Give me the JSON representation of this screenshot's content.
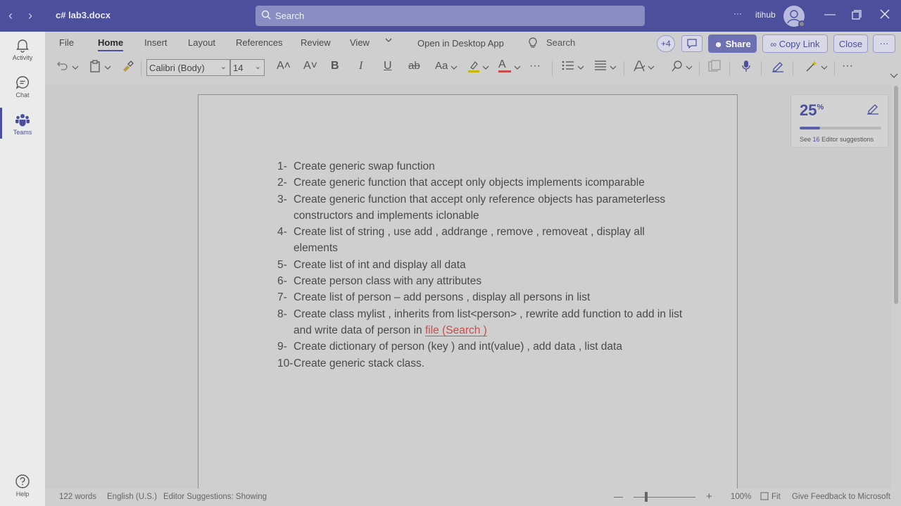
{
  "titlebar": {
    "back_glyph": "‹",
    "forward_glyph": "›",
    "doc_title": "c# lab3.docx",
    "search_placeholder": "Search",
    "more_glyph": "···",
    "org_name": "itihub"
  },
  "rail": {
    "items": [
      {
        "label": "Activity",
        "icon": "bell-icon"
      },
      {
        "label": "Chat",
        "icon": "chat-icon"
      },
      {
        "label": "Teams",
        "icon": "teams-icon"
      },
      {
        "label": "Help",
        "icon": "help-icon"
      }
    ],
    "active": "Teams"
  },
  "ribbon": {
    "tabs": [
      "File",
      "Home",
      "Insert",
      "Layout",
      "References",
      "Review",
      "View"
    ],
    "active_tab": "Home",
    "open_desktop": "Open in Desktop App",
    "search_label": "Search",
    "collaborators": "+4",
    "share": "Share",
    "copy_link": "Copy Link",
    "close": "Close",
    "font_name": "Calibri (Body)",
    "font_size": "14",
    "bold": "B",
    "italic": "I",
    "underline": "U",
    "strike": "ab",
    "case": "Aa",
    "font_color_glyph": "A",
    "grow_glyph": "A˄",
    "shrink_glyph": "A˅",
    "ellipsis": "···"
  },
  "document": {
    "items": [
      {
        "num": "1-",
        "text": "Create generic swap function"
      },
      {
        "num": "2-",
        "text": "Create generic function that accept only objects implements icomparable"
      },
      {
        "num": "3-",
        "text": "Create generic function that accept only reference objects has parameterless constructors and implements iclonable"
      },
      {
        "num": "4-",
        "text": "Create list of string , use add , addrange , remove , removeat , display all elements"
      },
      {
        "num": "5-",
        "text": "Create list of int and display all data"
      },
      {
        "num": "6-",
        "text": "Create person class with any attributes"
      },
      {
        "num": "7-",
        "text": "Create list of person – add persons , display all persons in list"
      },
      {
        "num": "8-",
        "text": "Create class mylist , inherits from list<person> , rewrite add function to add in list and write data of person in ",
        "highlight": "file (Search )"
      },
      {
        "num": "9-",
        "text": "Create dictionary of person (key ) and int(value) , add data , list data"
      },
      {
        "num": "10-",
        "text": "Create generic stack class."
      }
    ]
  },
  "editor": {
    "score": "25",
    "score_unit": "%",
    "score_value": 0.25,
    "see_prefix": "See",
    "count": "16",
    "see_suffix": "Editor suggestions"
  },
  "status": {
    "words": "122 words",
    "language": "English (U.S.)",
    "editor_status": "Editor Suggestions: Showing",
    "zoom_minus": "—",
    "zoom_plus": "+",
    "zoom": "100%",
    "fit": "Fit",
    "feedback": "Give Feedback to Microsoft"
  },
  "colors": {
    "accent": "#4b4f9c",
    "highlight_text": "#d04a4a"
  }
}
